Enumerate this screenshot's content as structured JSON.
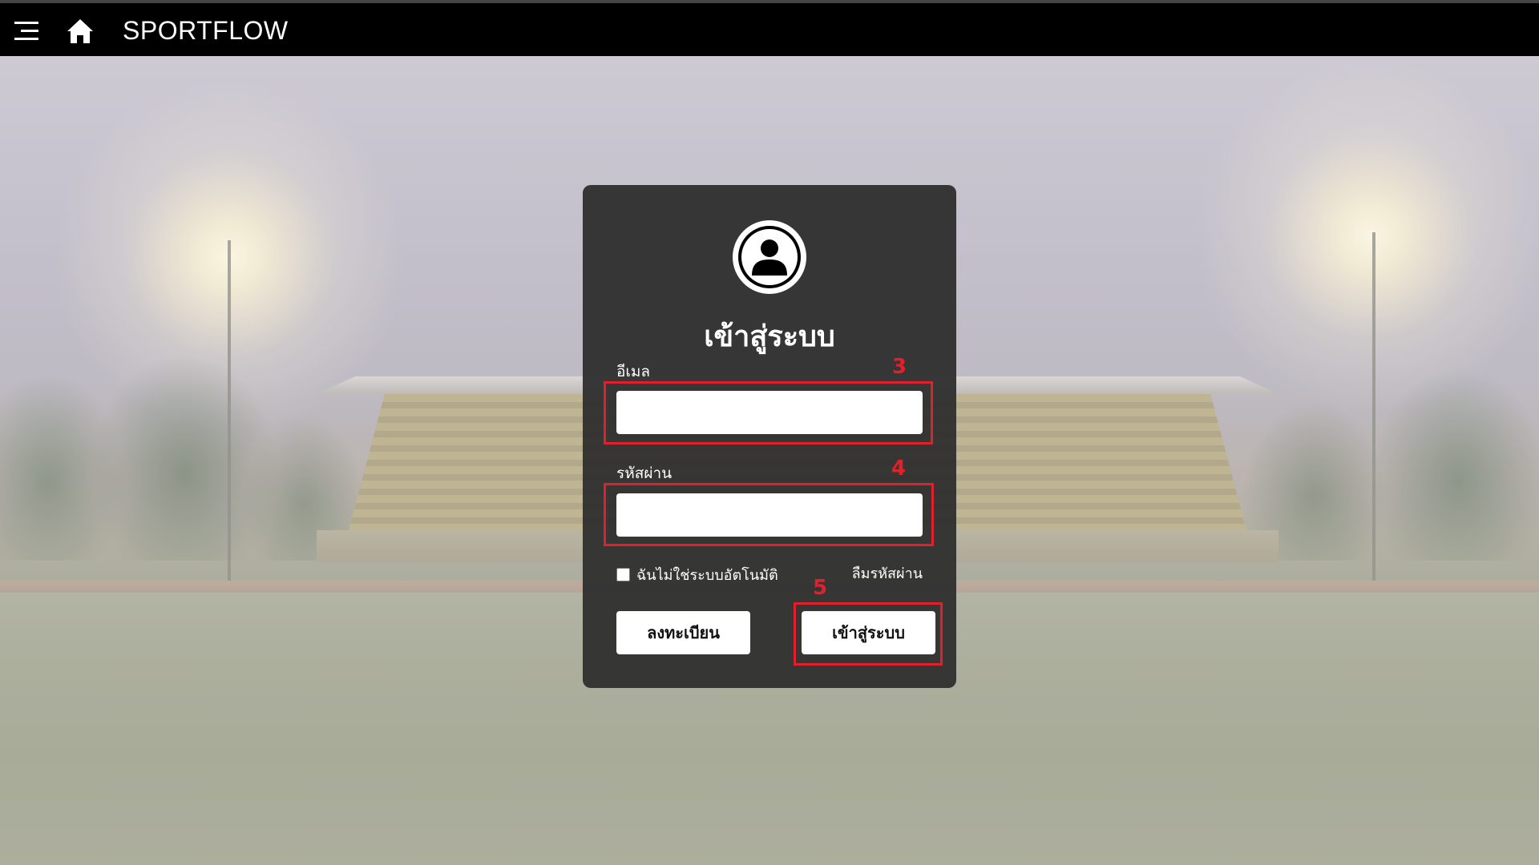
{
  "app": {
    "brand": "SPORTFLOW"
  },
  "topbar": {
    "menu_icon": "hamburger-menu-icon",
    "home_icon": "home-icon"
  },
  "login": {
    "avatar_icon": "user-circle-icon",
    "title": "เข้าสู่ระบบ",
    "email_label": "อีเมล",
    "email_value": "",
    "password_label": "รหัสผ่าน",
    "password_value": "",
    "captcha_label": "ฉันไม่ใช่ระบบอัตโนมัติ",
    "captcha_checked": false,
    "forgot_password": "ลืมรหัสผ่าน",
    "register_button": "ลงทะเบียน",
    "login_button": "เข้าสู่ระบบ"
  },
  "annotations": {
    "email": "3",
    "password": "4",
    "login_button": "5",
    "color": "#e0202a"
  }
}
